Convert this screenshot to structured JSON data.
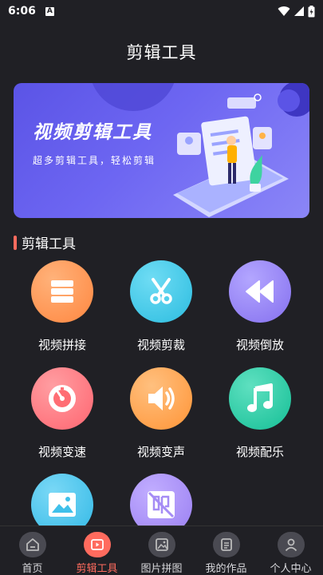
{
  "status": {
    "time": "6:06",
    "notif": "A"
  },
  "page": {
    "title": "剪辑工具"
  },
  "banner": {
    "title": "视频剪辑工具",
    "subtitle": "超多剪辑工具，轻松剪辑"
  },
  "section": {
    "title": "剪辑工具"
  },
  "tools": [
    {
      "label": "视频拼接",
      "icon": "list-icon",
      "color": "#ff8f4f"
    },
    {
      "label": "视频剪裁",
      "icon": "scissors-icon",
      "color": "#3fc7e6"
    },
    {
      "label": "视频倒放",
      "icon": "rewind-icon",
      "color": "#8e7cf2"
    },
    {
      "label": "视频变速",
      "icon": "speedometer-icon",
      "color": "#ff6d74"
    },
    {
      "label": "视频变声",
      "icon": "speaker-icon",
      "color": "#ff9c47"
    },
    {
      "label": "视频配乐",
      "icon": "music-note-icon",
      "color": "#1ec7a0"
    },
    {
      "label": "",
      "icon": "image-icon",
      "color": "#3fc0ea"
    },
    {
      "label": "",
      "icon": "watermark-icon",
      "color": "#a58cf5"
    }
  ],
  "tabbar": {
    "items": [
      {
        "label": "首页",
        "icon": "home-icon",
        "active": false
      },
      {
        "label": "剪辑工具",
        "icon": "video-icon",
        "active": true
      },
      {
        "label": "图片拼图",
        "icon": "image-icon",
        "active": false
      },
      {
        "label": "我的作品",
        "icon": "document-icon",
        "active": false
      },
      {
        "label": "个人中心",
        "icon": "user-icon",
        "active": false
      }
    ]
  }
}
